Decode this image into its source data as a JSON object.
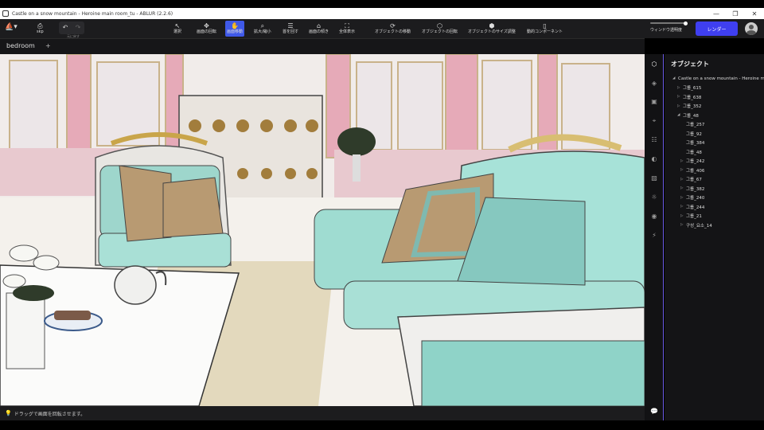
{
  "window": {
    "title": "Castle on a snow mountain - Heroine main room_tu - ABLUR (2.2.6)",
    "controls": [
      "—",
      "❐",
      "✕"
    ]
  },
  "toolbar": {
    "logo": "⛵▾",
    "skp_icon": "⎙",
    "skp_label": "skp",
    "undo": "↶",
    "redo": "↷",
    "undo_caption": "元に戻す",
    "tools": [
      {
        "icon": "↖",
        "label": "選択"
      },
      {
        "icon": "✥",
        "label": "画面の回転"
      },
      {
        "icon": "✋",
        "label": "画面移動"
      },
      {
        "icon": "⌕",
        "label": "拡大/縮小"
      },
      {
        "icon": "☰",
        "label": "首を回す"
      },
      {
        "icon": "⌂",
        "label": "画面の傾き"
      },
      {
        "icon": "⛶",
        "label": "全体表示"
      },
      {
        "icon": "⟳",
        "label": "オブジェクトの移動"
      },
      {
        "icon": "⬡",
        "label": "オブジェクトの回転"
      },
      {
        "icon": "⬢",
        "label": "オブジェクトのサイズ調整"
      },
      {
        "icon": "▯",
        "label": "動的コンポーネント"
      }
    ],
    "active_tool": "画面移動",
    "opacity_label": "ウィンドウ透明度",
    "opacity_value": 0.95,
    "render_label": "レンダー"
  },
  "tabs": {
    "current": "bedroom",
    "add": "+"
  },
  "status": {
    "icon": "💡",
    "message": "ドラッグで画面を回転させます。"
  },
  "rail": {
    "icons": [
      "cube-icon",
      "layers-icon",
      "material-icon",
      "scene-icon",
      "sliders-icon",
      "contrast-icon",
      "image-icon",
      "sun-icon",
      "camera-icon",
      "bolt-icon",
      "chat-icon"
    ],
    "glyphs": [
      "⬡",
      "◈",
      "▣",
      "⌖",
      "☷",
      "◐",
      "▨",
      "☼",
      "◉",
      "⚡",
      "💬"
    ]
  },
  "panel": {
    "title": "オブジェクト",
    "tree": [
      {
        "label": "Castle on a snow mountain - Heroine main room_tu",
        "arrow": "◢",
        "level": 0
      },
      {
        "label": "그룹_615",
        "arrow": "▷",
        "level": 1
      },
      {
        "label": "그룹_638",
        "arrow": "▷",
        "level": 1
      },
      {
        "label": "그룹_352",
        "arrow": "▷",
        "level": 1
      },
      {
        "label": "그룹_48",
        "arrow": "◢",
        "level": 1
      },
      {
        "label": "그룹_257",
        "arrow": "",
        "level": 2
      },
      {
        "label": "그룹_92",
        "arrow": "",
        "level": 2
      },
      {
        "label": "그룹_384",
        "arrow": "",
        "level": 2
      },
      {
        "label": "그룹_48",
        "arrow": "",
        "level": 2
      },
      {
        "label": "그룹_242",
        "arrow": "▷",
        "level": 2
      },
      {
        "label": "그룹_406",
        "arrow": "▷",
        "level": 2
      },
      {
        "label": "그룹_67",
        "arrow": "▷",
        "level": 2
      },
      {
        "label": "그룹_382",
        "arrow": "▷",
        "level": 2
      },
      {
        "label": "그룹_240",
        "arrow": "▷",
        "level": 2
      },
      {
        "label": "그룹_244",
        "arrow": "▷",
        "level": 2
      },
      {
        "label": "그룹_21",
        "arrow": "▷",
        "level": 2
      },
      {
        "label": "구성_요소_14",
        "arrow": "▷",
        "level": 2
      }
    ]
  },
  "colors": {
    "accent": "#3f59e8",
    "render_button": "#3f3ff0",
    "sofa": "#a9e0d6",
    "cushion": "#b89a72",
    "wall_pink": "#e6aab8"
  }
}
